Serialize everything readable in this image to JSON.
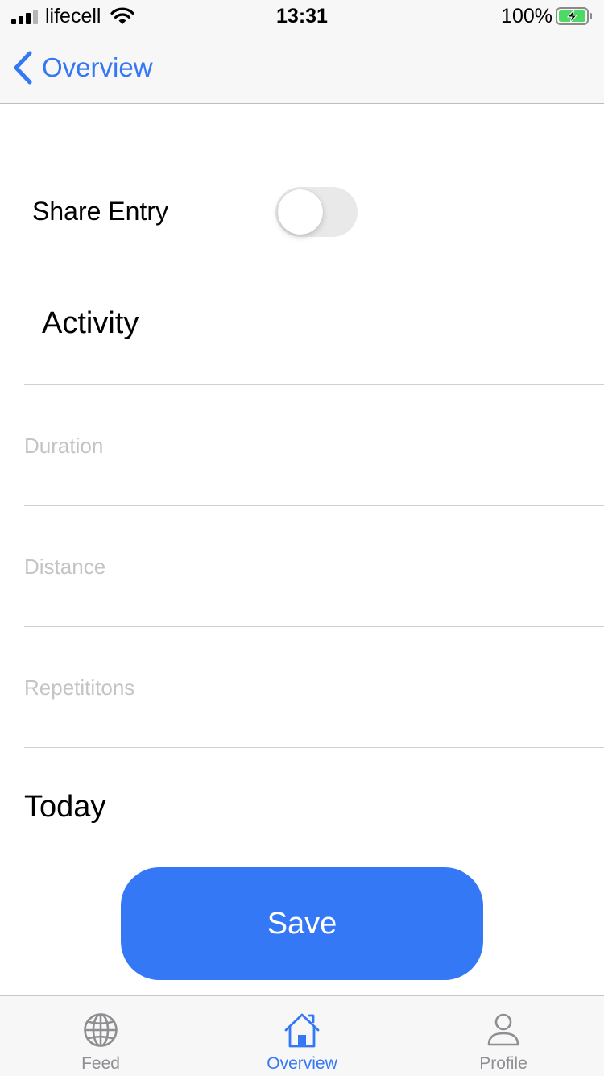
{
  "status_bar": {
    "carrier": "lifecell",
    "time": "13:31",
    "battery": "100%",
    "signal_icon": "cellular-signal-icon",
    "wifi_icon": "wifi-icon",
    "battery_icon": "battery-charging-icon"
  },
  "nav": {
    "back_label": "Overview",
    "back_icon": "chevron-left-icon"
  },
  "form": {
    "share_label": "Share Entry",
    "share_enabled": false,
    "activity_title": "Activity",
    "duration_placeholder": "Duration",
    "distance_placeholder": "Distance",
    "repetitions_placeholder": "Repetititons",
    "date_label": "Today",
    "save_label": "Save"
  },
  "tab_bar": {
    "tabs": [
      {
        "label": "Feed",
        "icon": "globe-icon",
        "selected": false
      },
      {
        "label": "Overview",
        "icon": "house-icon",
        "selected": true
      },
      {
        "label": "Profile",
        "icon": "person-icon",
        "selected": false
      }
    ]
  },
  "colors": {
    "accent": "#3478f6",
    "placeholder": "#c4c4c6",
    "toggle_off": "#e9e9ea",
    "tab_inactive": "#8e8e93",
    "battery_green": "#4cd964"
  }
}
